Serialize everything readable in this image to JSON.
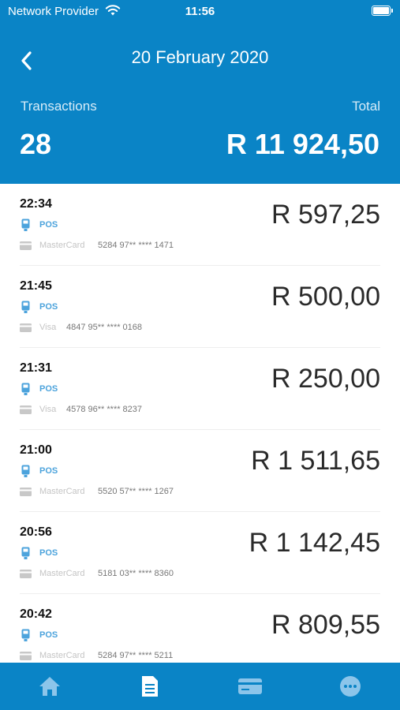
{
  "status_bar": {
    "carrier": "Network Provider",
    "time": "11:56",
    "wifi_icon": "wifi-icon",
    "battery_icon": "battery-icon"
  },
  "header": {
    "back_icon": "chevron-left-icon",
    "title": "20 February 2020",
    "transactions_label": "Transactions",
    "total_label": "Total",
    "transactions_count": "28",
    "total_value": "R 11 924,50"
  },
  "transactions": [
    {
      "time": "22:34",
      "amount": "R 597,25",
      "channel": "POS",
      "card_brand": "MasterCard",
      "card_number": "5284 97** **** 1471"
    },
    {
      "time": "21:45",
      "amount": "R 500,00",
      "channel": "POS",
      "card_brand": "Visa",
      "card_number": "4847 95** **** 0168"
    },
    {
      "time": "21:31",
      "amount": "R 250,00",
      "channel": "POS",
      "card_brand": "Visa",
      "card_number": "4578 96** **** 8237"
    },
    {
      "time": "21:00",
      "amount": "R 1 511,65",
      "channel": "POS",
      "card_brand": "MasterCard",
      "card_number": "5520 57** **** 1267"
    },
    {
      "time": "20:56",
      "amount": "R 1 142,45",
      "channel": "POS",
      "card_brand": "MasterCard",
      "card_number": "5181 03** **** 8360"
    },
    {
      "time": "20:42",
      "amount": "R 809,55",
      "channel": "POS",
      "card_brand": "MasterCard",
      "card_number": "5284 97** **** 5211"
    }
  ],
  "tab_bar": {
    "items": [
      {
        "icon": "home-icon",
        "active": false
      },
      {
        "icon": "document-icon",
        "active": true
      },
      {
        "icon": "card-icon",
        "active": false
      },
      {
        "icon": "more-icon",
        "active": false
      }
    ]
  },
  "colors": {
    "primary": "#0a84c6",
    "pos_label": "#4ca3dc",
    "tab_icon": "#8cc5ea",
    "tab_icon_active": "#ffffff"
  }
}
